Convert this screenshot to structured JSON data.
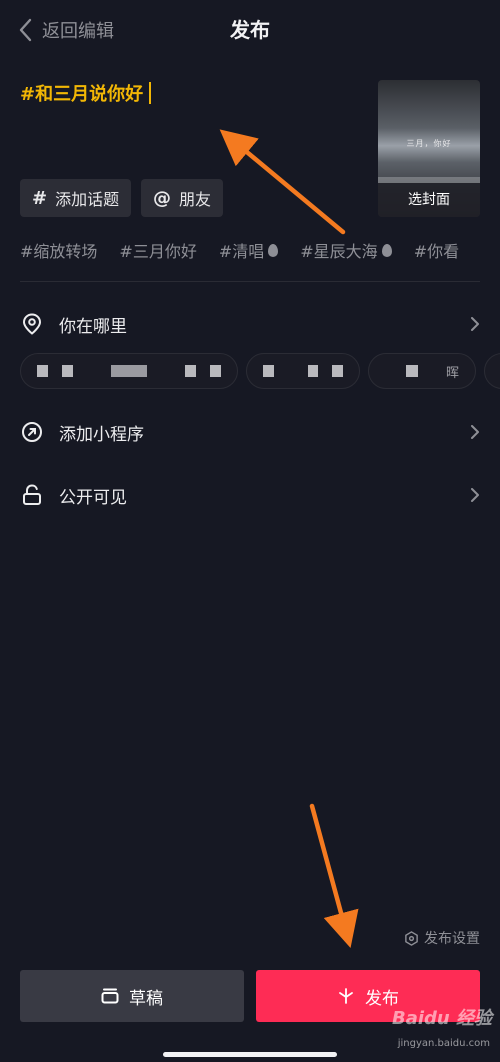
{
  "header": {
    "back_label": "返回编辑",
    "title": "发布"
  },
  "caption": {
    "text": "#和三月说你好"
  },
  "cover": {
    "overlay_text": "三月，你好",
    "select_label": "选封面"
  },
  "chips": {
    "topic_label": "添加话题",
    "topic_symbol": "#",
    "friend_label": "朋友",
    "friend_symbol": "@"
  },
  "trending_tags": [
    {
      "text": "#缩放转场",
      "hot": false
    },
    {
      "text": "#三月你好",
      "hot": false
    },
    {
      "text": "#清唱",
      "hot": true
    },
    {
      "text": "#星辰大海",
      "hot": true
    },
    {
      "text": "#你看",
      "hot": false
    }
  ],
  "rows": {
    "location": "你在哪里",
    "mini_program": "添加小程序",
    "visibility": "公开可见"
  },
  "location_chip_partial": "晖",
  "footer": {
    "settings_label": "发布设置",
    "draft_label": "草稿",
    "publish_label": "发布"
  },
  "watermark": {
    "brand": "Baidu 经验",
    "url": "jingyan.baidu.com"
  },
  "colors": {
    "background": "#161823",
    "accent_caption": "#f2b705",
    "publish": "#fe2c55",
    "draft": "#393a44",
    "annotation_arrow": "#f47a20"
  },
  "icons": [
    "chevron-left-icon",
    "location-pin-icon",
    "link-icon",
    "unlock-icon",
    "chevron-right-icon",
    "settings-hex-icon",
    "draft-box-icon",
    "sparkle-icon",
    "flame-icon"
  ]
}
